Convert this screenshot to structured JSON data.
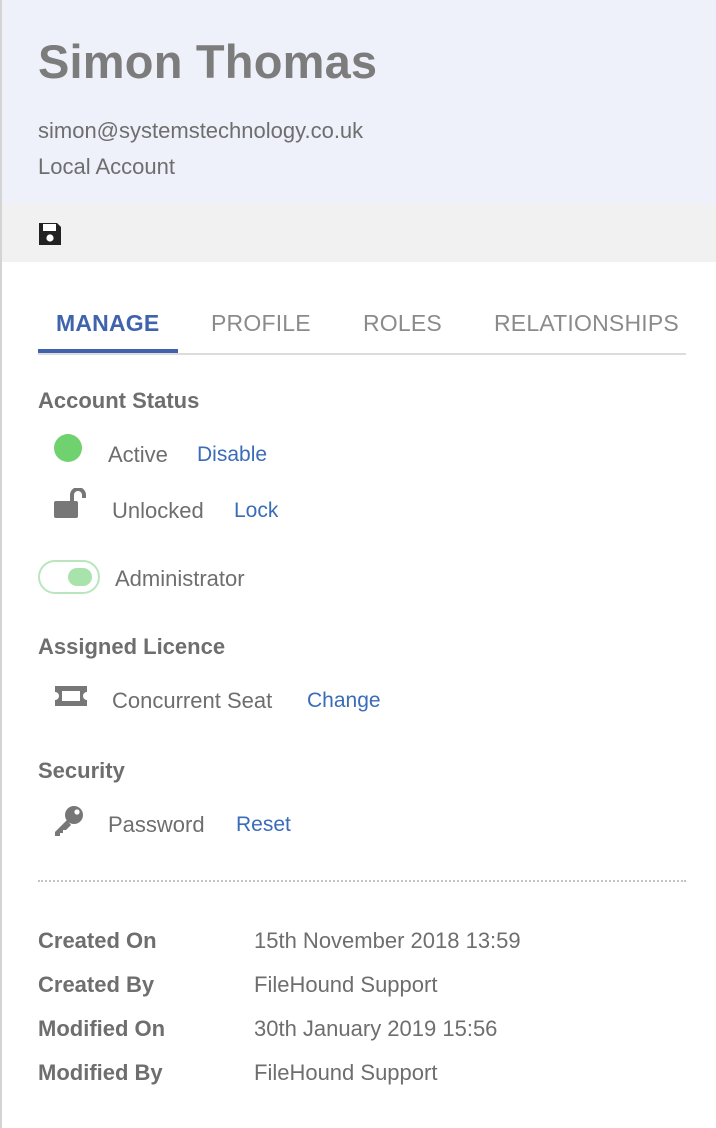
{
  "user": {
    "name": "Simon Thomas",
    "email": "simon@systemstechnology.co.uk",
    "account_type": "Local Account"
  },
  "toolbar": {
    "save_icon": "floppy-disk-icon"
  },
  "tabs": [
    {
      "label": "MANAGE",
      "active": true
    },
    {
      "label": "PROFILE",
      "active": false
    },
    {
      "label": "ROLES",
      "active": false
    },
    {
      "label": "RELATIONSHIPS",
      "active": false
    }
  ],
  "account_status": {
    "title": "Account Status",
    "status_label": "Active",
    "status_action": "Disable",
    "status_color": "#6fd26f",
    "lock_label": "Unlocked",
    "lock_action": "Lock",
    "lock_icon": "unlocked-padlock-icon",
    "admin_label": "Administrator",
    "admin_enabled": true
  },
  "licence": {
    "title": "Assigned Licence",
    "label": "Concurrent Seat",
    "action": "Change",
    "icon": "ticket-icon"
  },
  "security": {
    "title": "Security",
    "label": "Password",
    "action": "Reset",
    "icon": "key-icon"
  },
  "meta": [
    {
      "label": "Created On",
      "value": "15th November 2018 13:59"
    },
    {
      "label": "Created By",
      "value": "FileHound Support"
    },
    {
      "label": "Modified On",
      "value": "30th January 2019 15:56"
    },
    {
      "label": "Modified By",
      "value": "FileHound Support"
    }
  ],
  "colors": {
    "accent": "#3f63ad",
    "link": "#3a6cb9",
    "header_bg": "#eef1fa"
  }
}
